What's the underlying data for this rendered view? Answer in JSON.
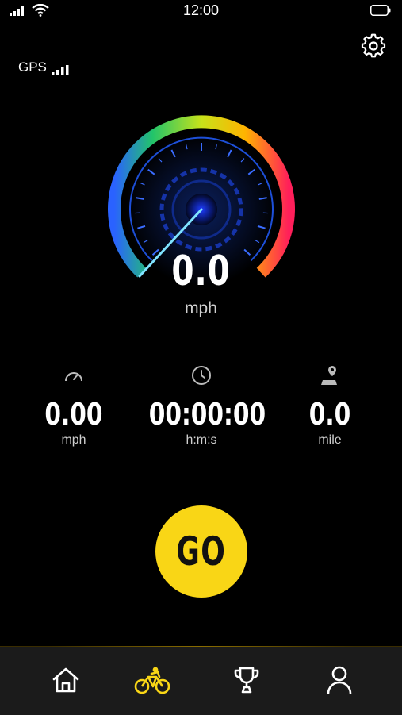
{
  "status_bar": {
    "time": "12:00",
    "icons": [
      "cellular-signal-icon",
      "wifi-icon",
      "battery-icon"
    ]
  },
  "gps": {
    "label": "GPS",
    "signal_bars": 4
  },
  "speedometer": {
    "speed": "0.0",
    "unit": "mph",
    "needle_value": 0,
    "colors": [
      "#2a62ff",
      "#22c46a",
      "#c7e21a",
      "#ffb400",
      "#ff1f5a"
    ]
  },
  "stats": [
    {
      "icon": "speedometer-icon",
      "value": "0.00",
      "label": "mph"
    },
    {
      "icon": "clock-icon",
      "value": "00:00:00",
      "label": "h:m:s"
    },
    {
      "icon": "location-pin-icon",
      "value": "0.0",
      "label": "mile"
    }
  ],
  "go_button": {
    "label": "GO",
    "color": "#f9d616"
  },
  "tabbar": {
    "items": [
      {
        "name": "home-icon",
        "active": false
      },
      {
        "name": "bicycle-icon",
        "active": true
      },
      {
        "name": "trophy-icon",
        "active": false
      },
      {
        "name": "profile-icon",
        "active": false
      }
    ],
    "active_color": "#f9d616",
    "inactive_color": "#ffffff"
  }
}
